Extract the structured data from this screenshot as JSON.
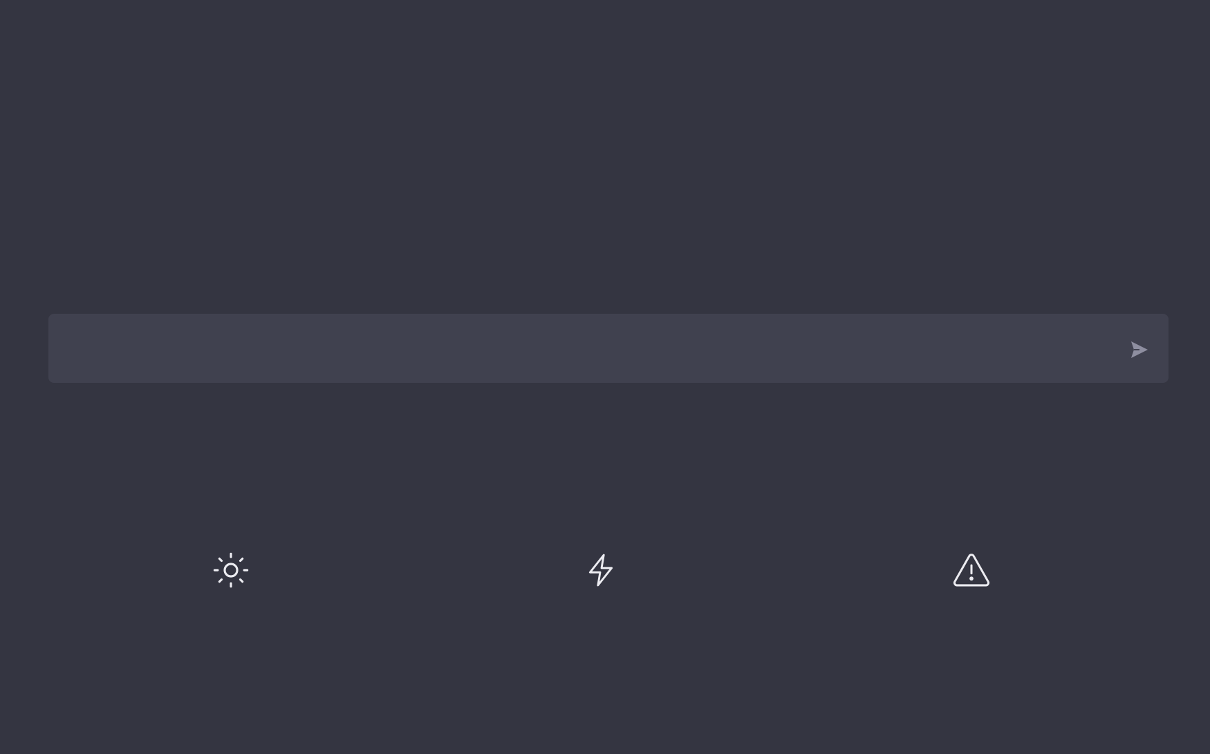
{
  "composer": {
    "placeholder": "",
    "value": "",
    "send_icon": "send-icon"
  },
  "columns": [
    {
      "icon": "sun-icon"
    },
    {
      "icon": "lightning-bolt-icon"
    },
    {
      "icon": "warning-triangle-icon"
    }
  ],
  "colors": {
    "background": "#343541",
    "composer_background": "#40414f",
    "icon": "#ececf1",
    "send_icon": "#8e8ea0"
  }
}
